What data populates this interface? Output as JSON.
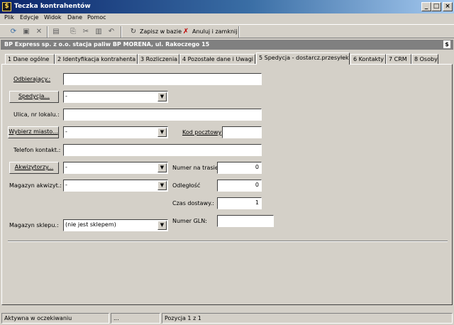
{
  "window": {
    "title": "Teczka kontrahentów",
    "icon": "dollar-icon",
    "controls": {
      "minimize": "_",
      "maximize": "□",
      "close": "×"
    }
  },
  "menu": [
    "Plik",
    "Edycje",
    "Widok",
    "Dane",
    "Pomoc"
  ],
  "toolbar": {
    "save_label": "Zapisz w bazie",
    "cancel_label": "Anuluj i zamknij"
  },
  "header": {
    "title": "BP Express sp. z o.o. stacja paliw BP MORENA, ul. Rakoczego 15"
  },
  "tabs": [
    "1 Dane ogólne",
    "2 Identyfikacja kontrahenta",
    "3 Rozliczenia",
    "4 Pozostałe dane i Uwagi",
    "5 Spedycja - dostarcz.przesyłek",
    "6 Kontakty",
    "7 CRM",
    "8 Osoby"
  ],
  "active_tab": "5 Spedycja - dostarcz.przesyłek",
  "form": {
    "odbierajacy": {
      "label": "Odbierający.:",
      "value": ""
    },
    "spedycja": {
      "button": "Spedycja...",
      "value": "-"
    },
    "ulica": {
      "label": "Ulica, nr lokalu.:",
      "value": ""
    },
    "miasto": {
      "button": "Wybierz miasto...",
      "value": "-"
    },
    "kod": {
      "label": "Kod pocztowy",
      "value": ""
    },
    "telefon": {
      "label": "Telefon kontakt.:",
      "value": ""
    },
    "akwizytorzy": {
      "button": "Akwizytorzy...",
      "value": "-"
    },
    "numer_trasie": {
      "label": "Numer na trasie",
      "value": "0"
    },
    "magazyn_akwizyt": {
      "label": "Magazyn akwizyt.:",
      "value": "-"
    },
    "odleglosc": {
      "label": "Odległość",
      "value": "0"
    },
    "czas_dostawy": {
      "label": "Czas dostawy.:",
      "value": "1"
    },
    "magazyn_sklepu": {
      "label": "Magazyn sklepu.:",
      "value": "(nie jest sklepem)"
    },
    "numer_gln": {
      "label": "Numer GLN:",
      "value": ""
    }
  },
  "status": {
    "state": "Aktywna w oczekiwaniu",
    "middle": "...",
    "position": "Pozycja 1 z 1"
  }
}
